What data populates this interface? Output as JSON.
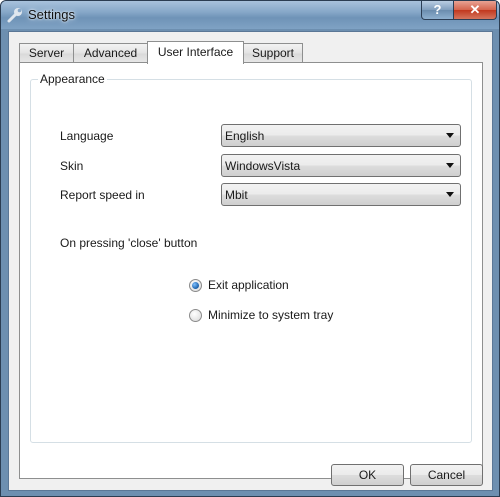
{
  "window": {
    "title": "Settings",
    "help_label": "?",
    "close_label": "✕"
  },
  "tabs": [
    {
      "label": "Server"
    },
    {
      "label": "Advanced"
    },
    {
      "label": "User Interface"
    },
    {
      "label": "Support"
    }
  ],
  "active_tab": "User Interface",
  "appearance": {
    "group_title": "Appearance",
    "language_label": "Language",
    "language_value": "English",
    "skin_label": "Skin",
    "skin_value": "WindowsVista",
    "speed_label": "Report speed in",
    "speed_value": "Mbit",
    "close_behavior_label": "On pressing 'close' button",
    "options": [
      {
        "label": "Exit application",
        "selected": true
      },
      {
        "label": "Minimize to system tray",
        "selected": false
      }
    ]
  },
  "buttons": {
    "ok": "OK",
    "cancel": "Cancel"
  },
  "colors": {
    "accent": "#1a5fa8",
    "close_button": "#c2381e",
    "titlebar": "#86a7c8"
  },
  "icons": {
    "app": "wrench-icon",
    "dropdown": "chevron-down-icon"
  }
}
